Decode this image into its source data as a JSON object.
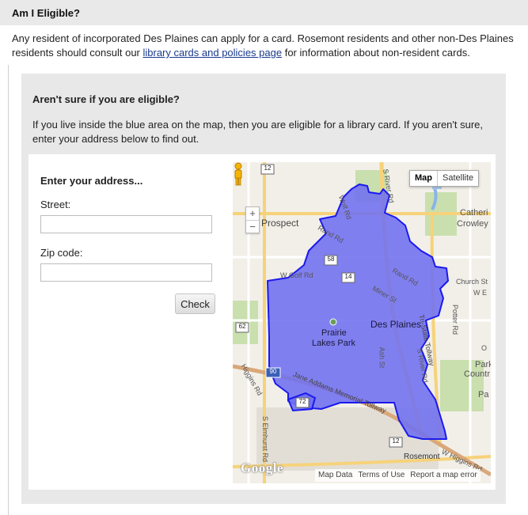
{
  "header": {
    "title": "Am I Eligible?"
  },
  "intro": {
    "text_before": "Any resident of incorporated Des Plaines can apply for a card. Rosemont residents and other non-Des Plaines residents should consult our ",
    "link_text": "library cards and policies page",
    "text_after": " for information about non-resident cards."
  },
  "panel": {
    "heading": "Aren't sure if you are eligible?",
    "text": "If you live inside the blue area on the map, then you are eligible for a library card. If you aren't sure, enter your address below to find out."
  },
  "form": {
    "title": "Enter your address...",
    "street_label": "Street:",
    "street_value": "",
    "zip_label": "Zip code:",
    "zip_value": "",
    "check_label": "Check"
  },
  "map": {
    "type_buttons": [
      "Map",
      "Satellite"
    ],
    "active_type": "Map",
    "zoom_in": "+",
    "zoom_out": "−",
    "google_logo": "Google",
    "footer": {
      "map_data": "Map Data",
      "terms": "Terms of Use",
      "report": "Report a map error"
    },
    "region_fill": "#6f6ff0",
    "region_stroke": "#1a1aee",
    "labels": {
      "des_plaines": "Des Plaines",
      "prairie_lakes_park": "Prairie Lakes Park",
      "prairie": "Prairie",
      "lakes_park": "Lakes Park",
      "prospect": "Prospect",
      "catherine_crowley": "Catheri Crowley",
      "catheri": "Catheri",
      "crowley": "Crowley",
      "park_country": "Park Countr",
      "park": "Park",
      "countr": "Countr",
      "pa": "Pa",
      "rosemont": "Rosemont",
      "church_st": "Church St",
      "w_e": "W E",
      "o": "O",
      "rand_rd": "Rand Rd",
      "rand_rd_2": "Rand Rd",
      "miner_st": "Miner St",
      "w_golf_rd": "W Golf Rd",
      "ash_st": "Ash St",
      "s_river_rd": "S River Rd",
      "s_river_rd_2": "S River Rd",
      "tri_state_tollway": "Tri-State Tollway",
      "jane_addams": "Jane Addams Memorial Tollway",
      "higgins_rd": "Higgins Rd",
      "w_higgins_rd": "W Higgins Rd",
      "s_elmhurst_rd": "S Elmhurst Rd",
      "potter_rd": "Potter Rd",
      "wolf_rd": "Wolf Rd",
      "route_12": "12",
      "route_12b": "12",
      "route_58": "58",
      "route_14": "14",
      "route_62": "62",
      "route_72": "72",
      "route_90": "90"
    }
  }
}
